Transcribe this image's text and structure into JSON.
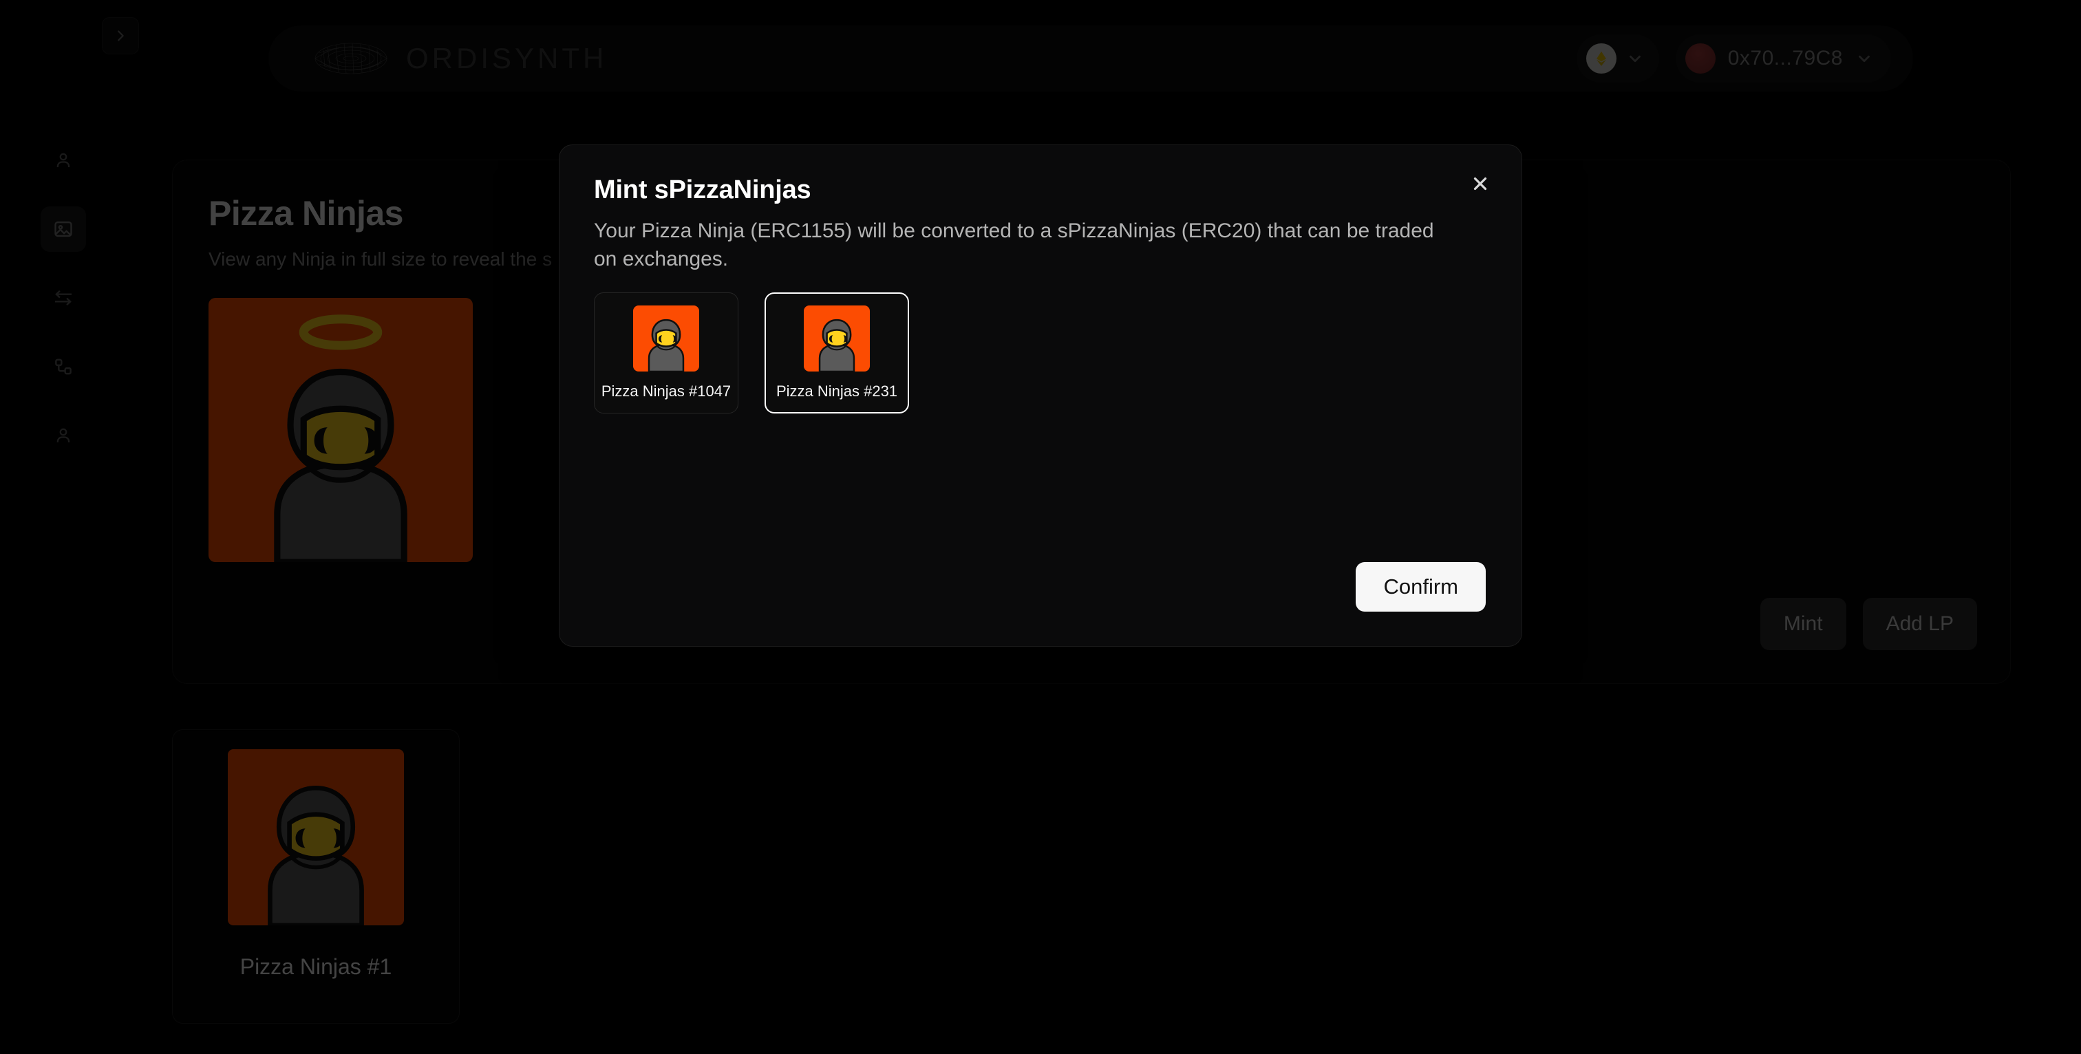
{
  "app": {
    "brand_name": "ORDISYNTH",
    "background": "#000000"
  },
  "sidebar": {
    "toggle_icon": "chevron-right-icon",
    "items": [
      {
        "icon": "user-icon",
        "label": "Profile",
        "active": false
      },
      {
        "icon": "image-icon",
        "label": "Gallery",
        "active": true
      },
      {
        "icon": "swap-arrows-icon",
        "label": "Swap",
        "active": false
      },
      {
        "icon": "nodes-icon",
        "label": "Pools",
        "active": false
      },
      {
        "icon": "user-icon",
        "label": "Account",
        "active": false
      }
    ]
  },
  "header": {
    "logo_icon": "wireframe-blob-logo",
    "network": {
      "icon": "eth-token-icon",
      "chevron": "chevron-down-icon"
    },
    "wallet": {
      "address": "0x70...79C8",
      "avatar": "wallet-avatar",
      "chevron": "chevron-down-icon"
    }
  },
  "main": {
    "title": "Pizza Ninjas",
    "subtitle": "View any Ninja in full size to reveal the s",
    "hero": {
      "name": "Pizza Ninja Hero",
      "bg_color": "#FC4C02",
      "has_halo": true
    },
    "actions": [
      {
        "label": "Mint",
        "name": "mint-button"
      },
      {
        "label": "Add LP",
        "name": "add-lp-button"
      }
    ],
    "nfts": [
      {
        "title": "Pizza Ninjas #1",
        "bg_color": "#FC4C02"
      }
    ]
  },
  "modal": {
    "title": "Mint sPizzaNinjas",
    "description": "Your Pizza Ninja (ERC1155) will be converted to a sPizzaNinjas (ERC20) that can be traded on exchanges.",
    "close_icon": "close-icon",
    "options": [
      {
        "title": "Pizza Ninjas #1047",
        "bg_color": "#FC4C02",
        "selected": false
      },
      {
        "title": "Pizza Ninjas #231",
        "bg_color": "#FC4C02",
        "selected": true
      }
    ],
    "confirm_label": "Confirm"
  },
  "colors": {
    "accent_orange": "#FC4C02",
    "mask_yellow": "#FFD21E",
    "hood_gray": "#5A5A5A",
    "panel_bg": "#070707",
    "modal_bg": "#0A0A0B",
    "primary_button_bg": "#F7F7F7"
  }
}
